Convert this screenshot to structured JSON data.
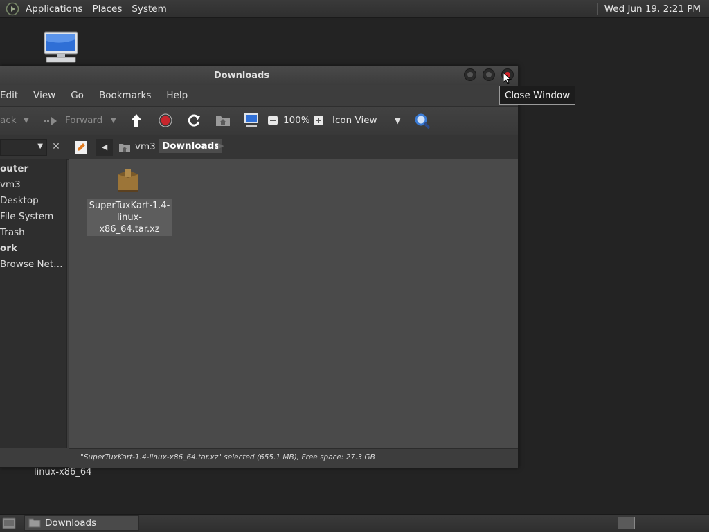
{
  "top_panel": {
    "menus": [
      "Applications",
      "Places",
      "System"
    ],
    "clock": "Wed Jun 19,  2:21 PM"
  },
  "desktop": {
    "file_label": "linux-x86_64"
  },
  "window": {
    "title": "Downloads",
    "menu": [
      "Edit",
      "View",
      "Go",
      "Bookmarks",
      "Help"
    ],
    "toolbar": {
      "back_label": "ack",
      "forward_label": "Forward",
      "zoom": "100%",
      "view_mode": "Icon View"
    },
    "breadcrumb": {
      "parent": "vm3",
      "current": "Downloads"
    },
    "sidebar": {
      "items": [
        {
          "label": "outer",
          "heading": true
        },
        {
          "label": "vm3"
        },
        {
          "label": "Desktop"
        },
        {
          "label": "File System"
        },
        {
          "label": "Trash"
        },
        {
          "label": "ork",
          "heading": true
        },
        {
          "label": "Browse Net…"
        }
      ]
    },
    "file": {
      "name_line1": "SuperTuxKart-1.4-",
      "name_line2": "linux-x86_64.tar.xz"
    },
    "status": "\"SuperTuxKart-1.4-linux-x86_64.tar.xz\" selected (655.1 MB), Free space: 27.3 GB"
  },
  "tooltip": "Close Window",
  "taskbar": {
    "task_label": "Downloads"
  },
  "colors": {
    "close_button": "#d4232a",
    "accent_search": "#3a7bd5"
  }
}
